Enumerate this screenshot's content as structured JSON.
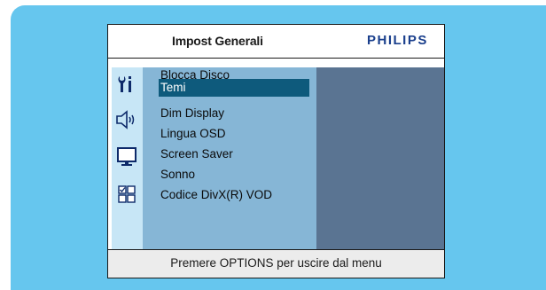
{
  "osd": {
    "title": "Impost Generali",
    "brand": "PHILIPS",
    "footer": "Premere OPTIONS per uscire dal menu",
    "icons": [
      "settings-icon",
      "speaker-icon",
      "monitor-icon",
      "preferences-grid-icon"
    ],
    "menu_items": [
      "Blocca Disco",
      "Temi",
      "Dim Display",
      "Lingua OSD",
      "Screen Saver",
      "Sonno",
      "Codice DivX(R) VOD"
    ],
    "selected_item": "Temi"
  },
  "colors": {
    "background_panel": "#66c6ee",
    "icon_column": "#c7e6f6",
    "menu_column": "#86b6d6",
    "submenu_column": "#5a7492",
    "selection": "#0e5a7c",
    "brand": "#1a3f8c"
  }
}
